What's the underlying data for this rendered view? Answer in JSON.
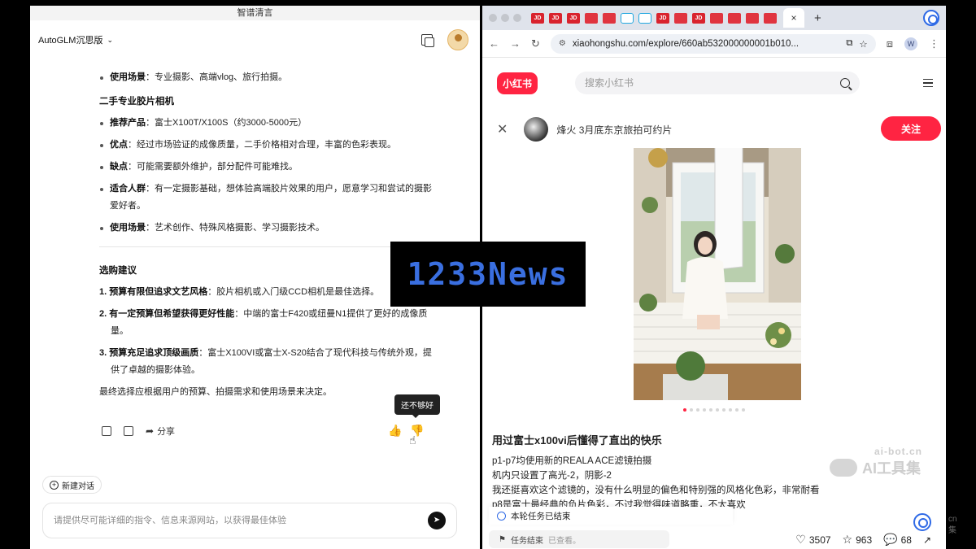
{
  "left": {
    "window_title": "智谱清言",
    "model_label": "AutoGLM沉思版",
    "content": {
      "bullet_use_cases_1": {
        "label": "使用场景",
        "text": "：专业摄影、高端vlog、旅行拍摄。"
      },
      "section_used_film": "二手专业胶片相机",
      "film_bullets": [
        {
          "label": "推荐产品",
          "text": "：富士X100T/X100S（约3000-5000元）"
        },
        {
          "label": "优点",
          "text": "：经过市场验证的成像质量，二手价格相对合理，丰富的色彩表现。"
        },
        {
          "label": "缺点",
          "text": "：可能需要额外维护，部分配件可能难找。"
        },
        {
          "label": "适合人群",
          "text": "：有一定摄影基础，想体验高端胶片效果的用户，愿意学习和尝试的摄影爱好者。"
        },
        {
          "label": "使用场景",
          "text": "：艺术创作、特殊风格摄影、学习摄影技术。"
        }
      ],
      "section_advice": "选购建议",
      "advice": [
        {
          "label": "1. 预算有限但追求文艺风格",
          "text": "：胶片相机或入门级CCD相机是最佳选择。"
        },
        {
          "label": "2. 有一定预算但希望获得更好性能",
          "text": "：中端的富士F420或纽曼N1提供了更好的成像质量。"
        },
        {
          "label": "3. 预算充足追求顶级画质",
          "text": "：富士X100VI或富士X-S20结合了现代科技与传统外观，提供了卓越的摄影体验。"
        }
      ],
      "final_line": "最终选择应根据用户的预算、拍摄需求和使用场景来决定。"
    },
    "actions": {
      "share_label": "分享",
      "tooltip": "还不够好"
    },
    "new_chat_label": "新建对话",
    "input_placeholder": "请提供尽可能详细的指令、信息来源网站，以获得最佳体验"
  },
  "browser": {
    "url": "xiaohongshu.com/explore/660ab532000000001b010...",
    "favicons": [
      "JD",
      "JD",
      "JD",
      "red",
      "red",
      "bili",
      "bili",
      "JD",
      "red",
      "JD",
      "red",
      "red",
      "red",
      "red"
    ],
    "tab_close": "×",
    "new_tab": "+",
    "profile_initial": "W"
  },
  "xhs": {
    "logo": "小红书",
    "search_placeholder": "搜索小红书",
    "author_name": "烽火 3月底东京旅拍可约片",
    "follow_label": "关注",
    "note_title": "用过富士x100vi后懂得了直出的快乐",
    "note_lines": [
      "p1-p7均使用新的REALA ACE滤镜拍摄",
      "机内只设置了高光-2，阴影-2",
      "我还挺喜欢这个滤镜的，没有什么明显的偏色和特别强的风格化色彩，非常耐看",
      "p8是富士最经典的负片色彩，不过我觉得味道略重，不太喜欢"
    ],
    "likes": "3507",
    "collects": "963",
    "comments": "68"
  },
  "task": {
    "ended": "本轮任务已结束",
    "row_label": "任务结束",
    "row_sub": "已查看。"
  },
  "watermark": {
    "small": "ai-bot.cn",
    "big": "AI工具集"
  },
  "overlay_logo": "1233News",
  "side_cut": [
    "cn",
    "集"
  ],
  "colors": {
    "xhs_red": "#ff2442",
    "accent_blue": "#2f6ae6"
  }
}
